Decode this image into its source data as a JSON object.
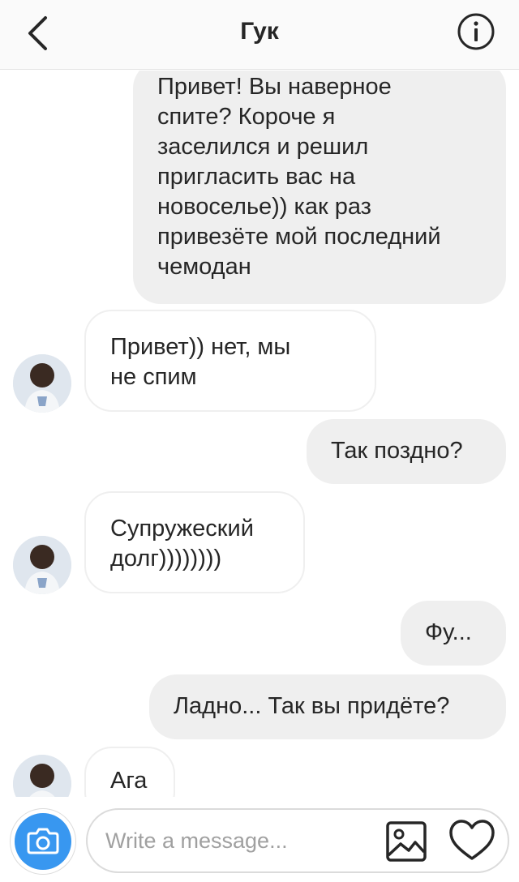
{
  "header": {
    "title": "Гук",
    "back_icon": "chevron-left-icon",
    "info_icon": "info-icon"
  },
  "messages": [
    {
      "side": "out",
      "text": "Привет! Вы наверное\nспите? Короче я\nзаселился и решил\nпригласить вас на\nновоселье)) как раз\nпривезёте мой последний\nчемодан"
    },
    {
      "side": "in",
      "text": "Привет)) нет, мы\nне спим"
    },
    {
      "side": "out",
      "text": "Так поздно?"
    },
    {
      "side": "in",
      "text": "Супружеский\nдолг))))))))"
    },
    {
      "side": "out",
      "text": "Фу..."
    },
    {
      "side": "out",
      "text": "Ладно... Так вы придёте?"
    },
    {
      "side": "in",
      "text": "Ага"
    }
  ],
  "composer": {
    "placeholder": "Write a message...",
    "camera_icon": "camera-icon",
    "gallery_icon": "image-icon",
    "like_icon": "heart-icon"
  },
  "colors": {
    "accent": "#3897f0",
    "bubble_out": "#efefef",
    "bubble_in_border": "#efefef",
    "text": "#262626",
    "placeholder": "#a0a0a0"
  }
}
